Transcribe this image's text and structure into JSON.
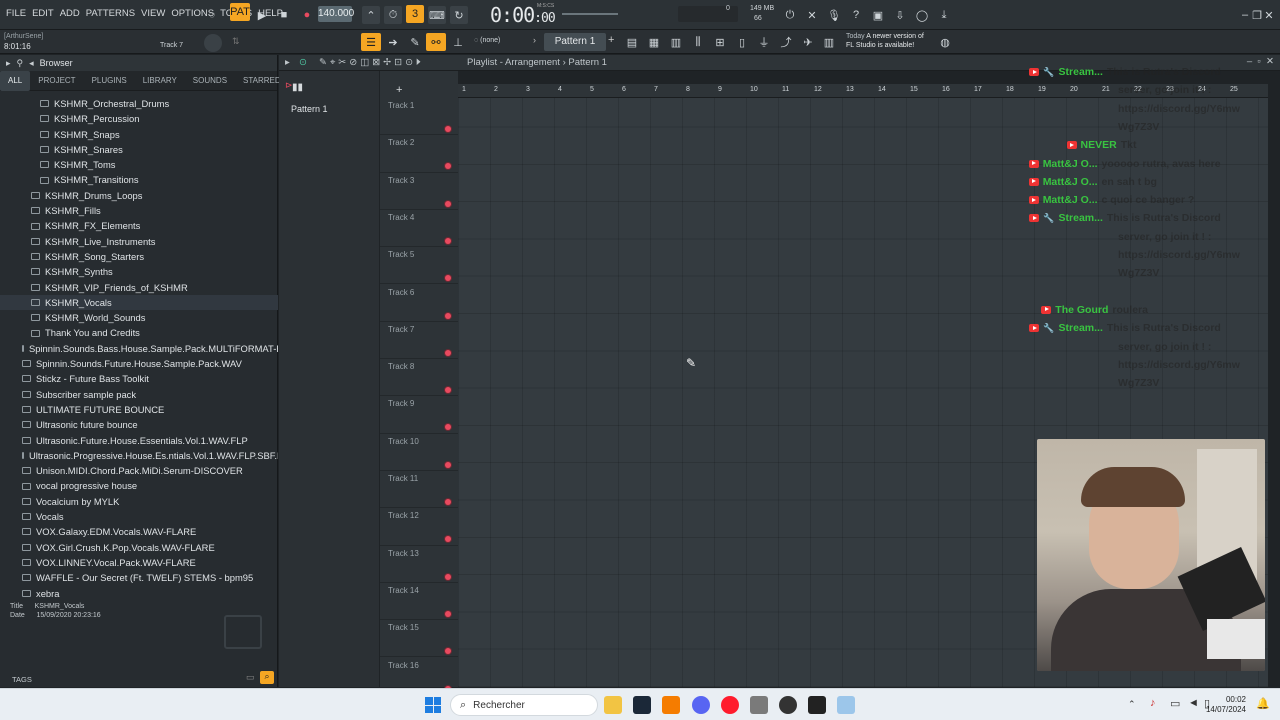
{
  "menu": [
    "FILE",
    "EDIT",
    "ADD",
    "PATTERNS",
    "VIEW",
    "OPTIONS",
    "TOOLS",
    "HELP"
  ],
  "transport": {
    "tempo": "140.000",
    "time": "0:00",
    "time_small": ":00",
    "time_label": "M:S:CS",
    "memory": "149 MB",
    "cpu_value": "66",
    "cpu_value2": "0"
  },
  "hint": {
    "user": "[ArthurSene]",
    "position": "8:01:16",
    "track": "Track 7",
    "pattern_select": "(none)",
    "pattern": "Pattern 1",
    "news_date": "Today",
    "news_text_1": "A newer version of",
    "news_text_2": "FL Studio is available!"
  },
  "browser": {
    "title": "Browser",
    "tabs": [
      "ALL",
      "PROJECT",
      "PLUGINS",
      "LIBRARY",
      "SOUNDS",
      "STARRED"
    ],
    "items": [
      {
        "label": "KSHMR_Orchestral_Drums",
        "indent": 2
      },
      {
        "label": "KSHMR_Percussion",
        "indent": 2
      },
      {
        "label": "KSHMR_Snaps",
        "indent": 2
      },
      {
        "label": "KSHMR_Snares",
        "indent": 2
      },
      {
        "label": "KSHMR_Toms",
        "indent": 2
      },
      {
        "label": "KSHMR_Transitions",
        "indent": 2
      },
      {
        "label": "KSHMR_Drums_Loops",
        "indent": 1
      },
      {
        "label": "KSHMR_Fills",
        "indent": 1
      },
      {
        "label": "KSHMR_FX_Elements",
        "indent": 1
      },
      {
        "label": "KSHMR_Live_Instruments",
        "indent": 1
      },
      {
        "label": "KSHMR_Song_Starters",
        "indent": 1
      },
      {
        "label": "KSHMR_Synths",
        "indent": 1
      },
      {
        "label": "KSHMR_VIP_Friends_of_KSHMR",
        "indent": 1
      },
      {
        "label": "KSHMR_Vocals",
        "indent": 1
      },
      {
        "label": "KSHMR_World_Sounds",
        "indent": 1
      },
      {
        "label": "Thank You and Credits",
        "indent": 1
      },
      {
        "label": "Spinnin.Sounds.Bass.House.Sample.Pack.MULTiFORMAT-FLARE",
        "indent": 0
      },
      {
        "label": "Spinnin.Sounds.Future.House.Sample.Pack.WAV",
        "indent": 0
      },
      {
        "label": "Stickz - Future Bass Toolkit",
        "indent": 0
      },
      {
        "label": "Subscriber sample pack",
        "indent": 0
      },
      {
        "label": "ULTIMATE FUTURE BOUNCE",
        "indent": 0
      },
      {
        "label": "Ultrasonic future bounce",
        "indent": 0
      },
      {
        "label": "Ultrasonic.Future.House.Essentials.Vol.1.WAV.FLP",
        "indent": 0
      },
      {
        "label": "Ultrasonic.Progressive.House.Es.ntials.Vol.1.WAV.FLP.SBF.FXB.FXP",
        "indent": 0
      },
      {
        "label": "Unison.MIDI.Chord.Pack.MiDi.Serum-DISCOVER",
        "indent": 0
      },
      {
        "label": "vocal progressive house",
        "indent": 0
      },
      {
        "label": "Vocalcium by MYLK",
        "indent": 0
      },
      {
        "label": "Vocals",
        "indent": 0
      },
      {
        "label": "VOX.Galaxy.EDM.Vocals.WAV-FLARE",
        "indent": 0
      },
      {
        "label": "VOX.Girl.Crush.K.Pop.Vocals.WAV-FLARE",
        "indent": 0
      },
      {
        "label": "VOX.LINNEY.Vocal.Pack.WAV-FLARE",
        "indent": 0
      },
      {
        "label": "WAFFLE - Our Secret (Ft. TWELF) STEMS - bpm95",
        "indent": 0
      },
      {
        "label": "xebra",
        "indent": 0
      }
    ],
    "info_title_label": "Title",
    "info_title": "KSHMR_Vocals",
    "info_date_label": "Date",
    "info_date": "15/09/2020 20:23:16",
    "tags": "TAGS"
  },
  "playlist": {
    "title": "Playlist - Arrangement",
    "pattern": "Pattern 1",
    "pattern_list": [
      "Pattern 1"
    ],
    "tracks": [
      "Track 1",
      "Track 2",
      "Track 3",
      "Track 4",
      "Track 5",
      "Track 6",
      "Track 7",
      "Track 8",
      "Track 9",
      "Track 10",
      "Track 11",
      "Track 12",
      "Track 13",
      "Track 14",
      "Track 15",
      "Track 16"
    ],
    "ruler": [
      "1",
      "2",
      "3",
      "4",
      "5",
      "6",
      "7",
      "8",
      "9",
      "10",
      "11",
      "12",
      "13",
      "14",
      "15",
      "16",
      "17",
      "18",
      "19",
      "20",
      "21",
      "22",
      "23",
      "24",
      "25"
    ]
  },
  "chat": [
    {
      "name": "Stream...",
      "msg": "This is Rutra's Discord",
      "wrench": true
    },
    {
      "name": "",
      "msg": "server, go join it ! :"
    },
    {
      "name": "",
      "msg": "https://discord.gg/Y6mw"
    },
    {
      "name": "",
      "msg": "Wg7Z3V"
    },
    {
      "name": "NEVER",
      "msg": "Tkt",
      "wrench": false
    },
    {
      "name": "Matt&J O...",
      "msg": "yooooo rutra, avas here",
      "wrench": false
    },
    {
      "name": "Matt&J O...",
      "msg": "en sah t bg",
      "wrench": false
    },
    {
      "name": "Matt&J O...",
      "msg": "c quoi ce banger ?",
      "wrench": false
    },
    {
      "name": "Stream...",
      "msg": "This is Rutra's Discord",
      "wrench": true
    },
    {
      "name": "",
      "msg": "server, go join it ! :"
    },
    {
      "name": "",
      "msg": "https://discord.gg/Y6mw"
    },
    {
      "name": "",
      "msg": "Wg7Z3V"
    },
    {
      "name": "",
      "msg": ""
    },
    {
      "name": "The Gourd",
      "msg": "roulera",
      "wrench": false
    },
    {
      "name": "Stream...",
      "msg": "This is Rutra's Discord",
      "wrench": true
    },
    {
      "name": "",
      "msg": "server, go join it ! :"
    },
    {
      "name": "",
      "msg": "https://discord.gg/Y6mw"
    },
    {
      "name": "",
      "msg": "Wg7Z3V"
    }
  ],
  "taskbar": {
    "search": "Rechercher",
    "time": "00:02",
    "date": "14/07/2024"
  },
  "colors": {
    "accent": "#f5a623",
    "led": "#e84a5f",
    "chat_name": "#39c441"
  }
}
